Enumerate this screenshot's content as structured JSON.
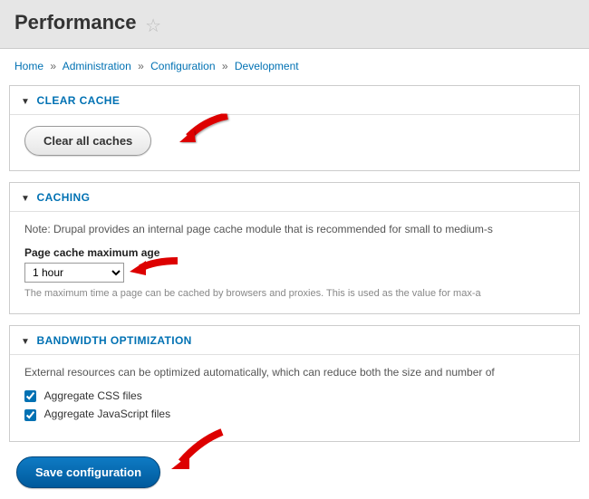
{
  "header": {
    "title": "Performance"
  },
  "breadcrumb": {
    "items": [
      "Home",
      "Administration",
      "Configuration",
      "Development"
    ],
    "sep": "»"
  },
  "panels": {
    "clear_cache": {
      "title": "CLEAR CACHE",
      "button": "Clear all caches"
    },
    "caching": {
      "title": "CACHING",
      "note": "Note: Drupal provides an internal page cache module that is recommended for small to medium-s",
      "field_label": "Page cache maximum age",
      "selected": "1 hour",
      "helper": "The maximum time a page can be cached by browsers and proxies. This is used as the value for max-a"
    },
    "bandwidth": {
      "title": "BANDWIDTH OPTIMIZATION",
      "note": "External resources can be optimized automatically, which can reduce both the size and number of",
      "cb1": "Aggregate CSS files",
      "cb2": "Aggregate JavaScript files"
    }
  },
  "actions": {
    "save": "Save configuration"
  }
}
